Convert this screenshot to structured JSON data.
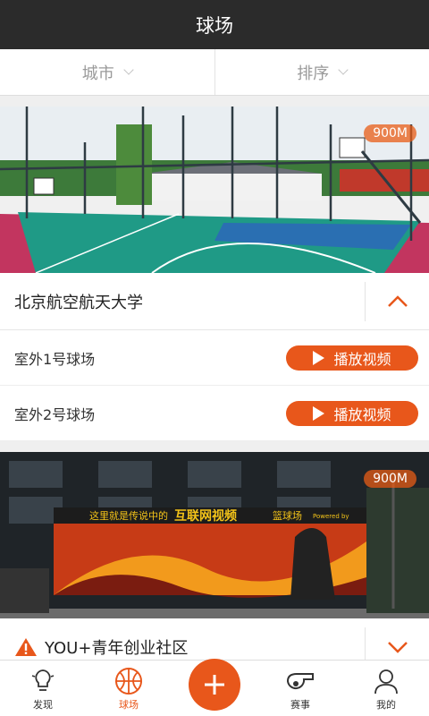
{
  "header": {
    "title": "球场"
  },
  "filters": {
    "city": "城市",
    "sort": "排序"
  },
  "venues": [
    {
      "distance": "900M",
      "name": "北京航空航天大学",
      "courts": [
        {
          "name": "室外1号球场",
          "action": "播放视频"
        },
        {
          "name": "室外2号球场",
          "action": "播放视频"
        }
      ]
    },
    {
      "distance": "900M",
      "name": "YOU+青年创业社区",
      "mural": {
        "headline": "这里就是传说中的",
        "highlight": "互联网视频",
        "tail": "篮球场",
        "powered": "Powered by"
      }
    }
  ],
  "tabbar": {
    "discover": "发现",
    "courts": "球场",
    "events": "赛事",
    "mine": "我的"
  },
  "colors": {
    "accent": "#e8571b",
    "header": "#2b2b2b"
  }
}
